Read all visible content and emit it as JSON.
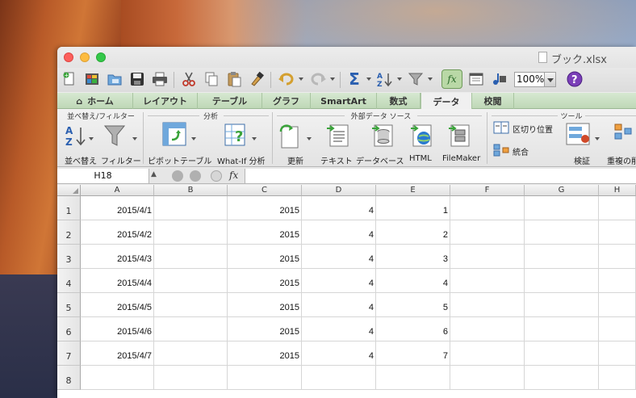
{
  "window": {
    "title": "ブック.xlsx"
  },
  "toolbar": {
    "zoom": "100%",
    "items": [
      "new-document-icon",
      "open-icon",
      "gallery-icon",
      "save-icon",
      "print-icon",
      "cut-icon",
      "copy-icon",
      "paste-icon",
      "format-painter-icon",
      "undo-icon",
      "redo-icon",
      "autosum-icon",
      "sort-icon",
      "filter-icon",
      "formula-builder-icon",
      "toolbox-icon",
      "media-browser-icon",
      "help-icon"
    ]
  },
  "ribbon_tabs": [
    {
      "label": "ホーム",
      "icon": "home-icon"
    },
    {
      "label": "レイアウト"
    },
    {
      "label": "テーブル"
    },
    {
      "label": "グラフ"
    },
    {
      "label": "SmartArt"
    },
    {
      "label": "数式"
    },
    {
      "label": "データ",
      "active": true
    },
    {
      "label": "校閲"
    }
  ],
  "ribbon": {
    "groups": {
      "sort_filter": "並べ替え/フィルター",
      "analysis": "分析",
      "external": "外部データ ソース",
      "tools": "ツール"
    },
    "buttons": {
      "sort": "並べ替え",
      "filter": "フィルター",
      "pivot": "ピボットテーブル",
      "whatif": "What-If 分析",
      "refresh": "更新",
      "text": "テキスト",
      "database": "データベース",
      "html": "HTML",
      "filemaker": "FileMaker",
      "text_to_columns": "区切り位置",
      "consolidate": "統合",
      "validate": "検証",
      "remove_duplicates": "重複の削"
    }
  },
  "formula_bar": {
    "name_box": "H18",
    "fx": "fx",
    "value": ""
  },
  "sheet": {
    "columns": [
      "A",
      "B",
      "C",
      "D",
      "E",
      "F",
      "G",
      "H"
    ],
    "rows": [
      {
        "num": "1",
        "cells": [
          "2015/4/1",
          "",
          "2015",
          "4",
          "1",
          "",
          "",
          ""
        ]
      },
      {
        "num": "2",
        "cells": [
          "2015/4/2",
          "",
          "2015",
          "4",
          "2",
          "",
          "",
          ""
        ]
      },
      {
        "num": "3",
        "cells": [
          "2015/4/3",
          "",
          "2015",
          "4",
          "3",
          "",
          "",
          ""
        ]
      },
      {
        "num": "4",
        "cells": [
          "2015/4/4",
          "",
          "2015",
          "4",
          "4",
          "",
          "",
          ""
        ]
      },
      {
        "num": "5",
        "cells": [
          "2015/4/5",
          "",
          "2015",
          "4",
          "5",
          "",
          "",
          ""
        ]
      },
      {
        "num": "6",
        "cells": [
          "2015/4/6",
          "",
          "2015",
          "4",
          "6",
          "",
          "",
          ""
        ]
      },
      {
        "num": "7",
        "cells": [
          "2015/4/7",
          "",
          "2015",
          "4",
          "7",
          "",
          "",
          ""
        ]
      },
      {
        "num": "8",
        "cells": [
          "",
          "",
          "",
          "",
          "",
          "",
          "",
          ""
        ]
      }
    ]
  }
}
